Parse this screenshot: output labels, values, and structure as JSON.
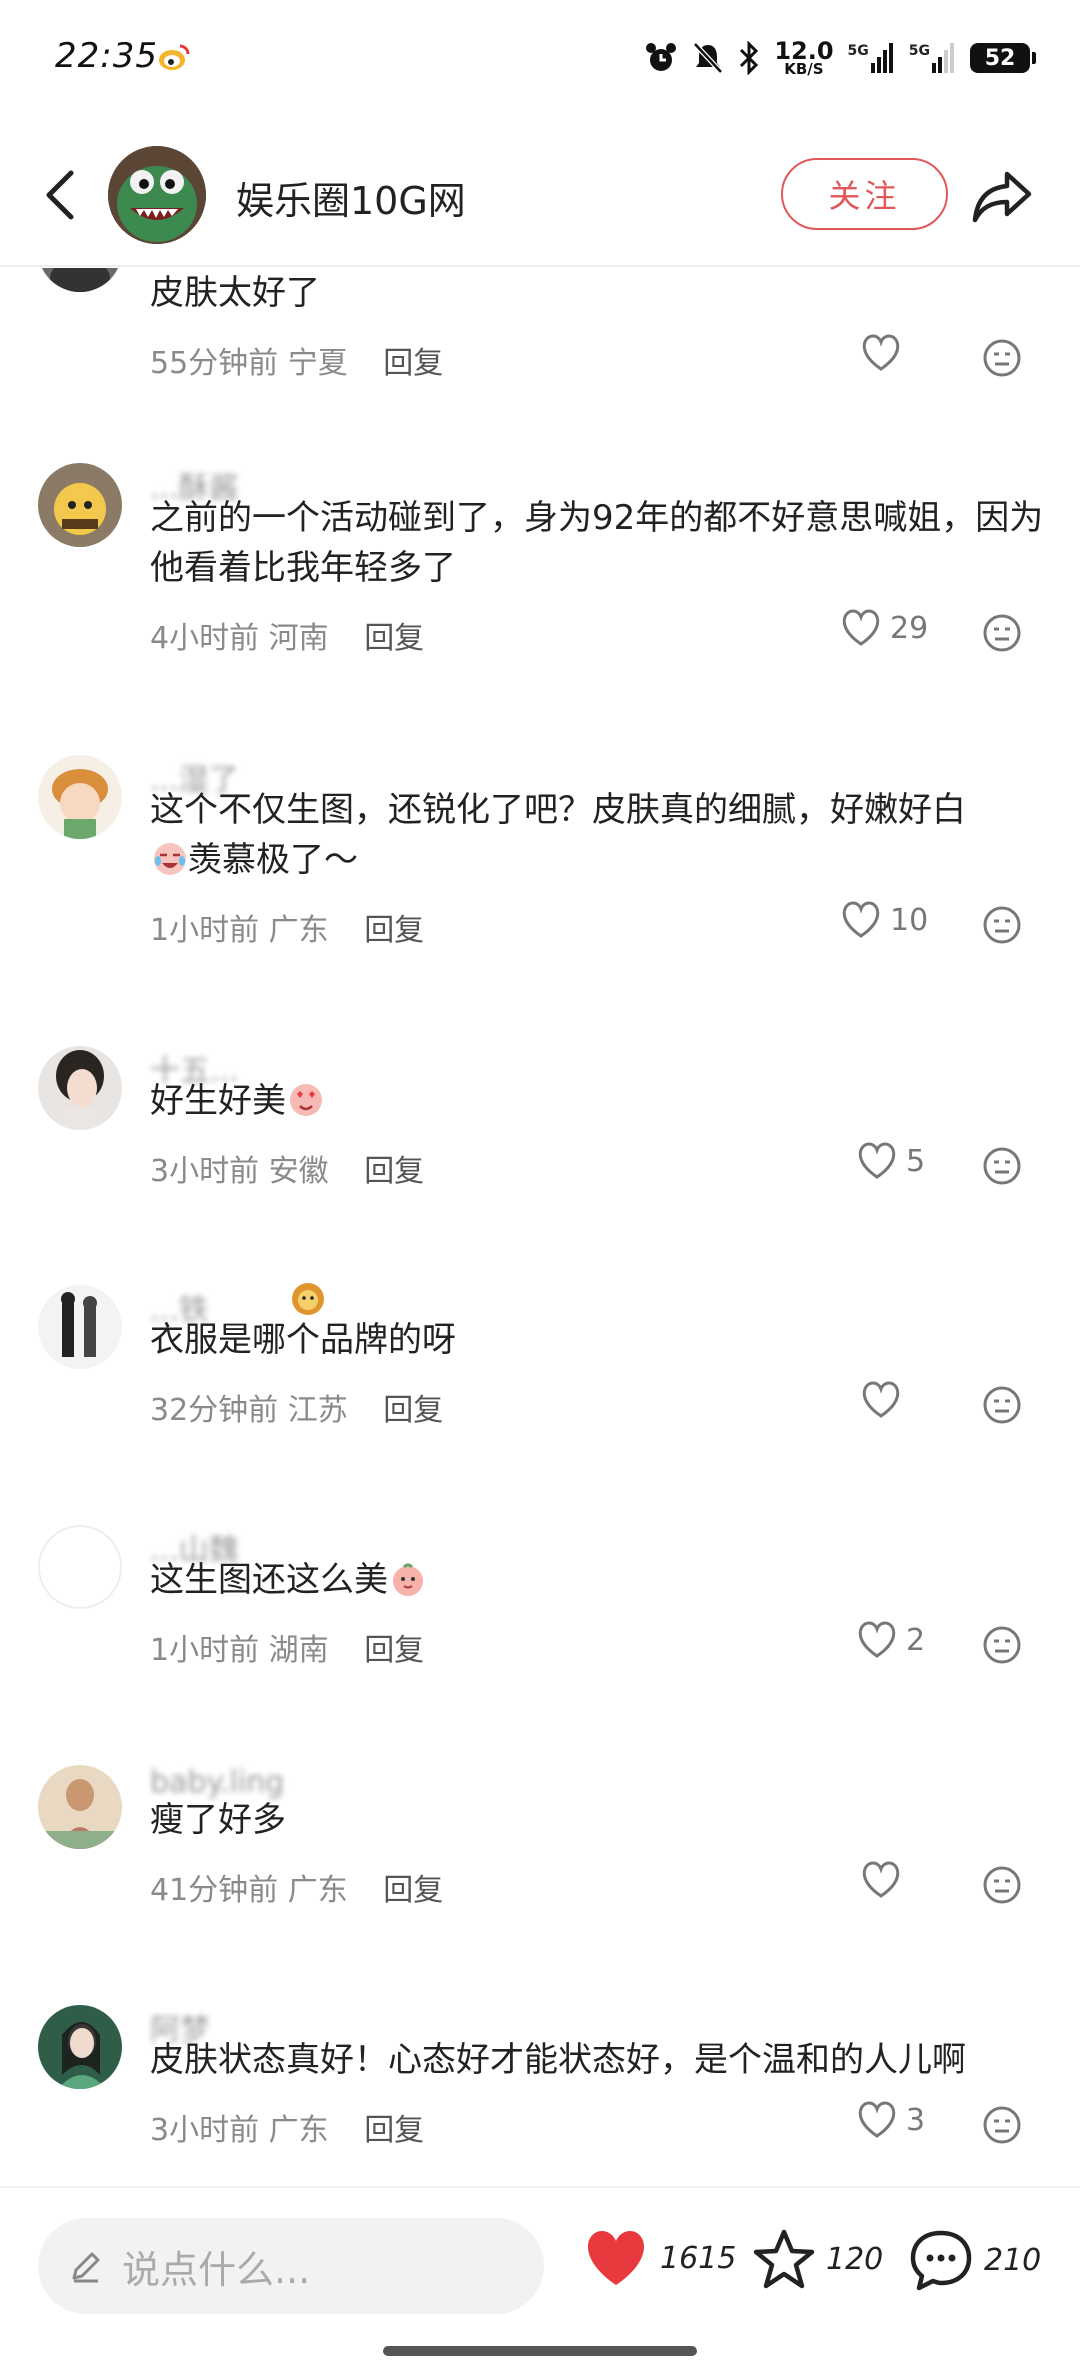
{
  "status_bar": {
    "time": "22:35",
    "net_speed_value": "12.0",
    "net_speed_unit": "KB/S",
    "signal_1": "5G",
    "signal_2": "5G",
    "battery": "52"
  },
  "header": {
    "title": "娱乐圈10G网",
    "follow_label": "关注"
  },
  "comments": [
    {
      "username": "",
      "text": "皮肤太好了",
      "time": "55分钟前",
      "location": "宁夏",
      "reply": "回复",
      "likes": ""
    },
    {
      "username": "...酥酱",
      "text": "之前的一个活动碰到了，身为92年的都不好意思喊姐，因为他看着比我年轻多了",
      "time": "4小时前",
      "location": "河南",
      "reply": "回复",
      "likes": "29"
    },
    {
      "username": "...湿了",
      "text": "这个不仅生图，还锐化了吧？皮肤真的细腻，好嫩好白",
      "text_after": "羡慕极了～",
      "time": "1小时前",
      "location": "广东",
      "reply": "回复",
      "likes": "10"
    },
    {
      "username": "十五...",
      "text": "好生好美",
      "time": "3小时前",
      "location": "安徽",
      "reply": "回复",
      "likes": "5"
    },
    {
      "username": "...铁",
      "text": "衣服是哪个品牌的呀",
      "time": "32分钟前",
      "location": "江苏",
      "reply": "回复",
      "likes": ""
    },
    {
      "username": "...山魏",
      "text": "这生图还这么美",
      "time": "1小时前",
      "location": "湖南",
      "reply": "回复",
      "likes": "2"
    },
    {
      "username": "baby.ling",
      "text": "瘦了好多",
      "time": "41分钟前",
      "location": "广东",
      "reply": "回复",
      "likes": ""
    },
    {
      "username": "阿梦",
      "text": "皮肤状态真好！心态好才能状态好，是个温和的人儿啊",
      "time": "3小时前",
      "location": "广东",
      "reply": "回复",
      "likes": "3"
    }
  ],
  "bottom_bar": {
    "input_placeholder": "说点什么...",
    "like_count": "1615",
    "favorite_count": "120",
    "comment_count": "210"
  },
  "colors": {
    "accent_red": "#e0585a",
    "heart_red": "#e8393f"
  },
  "icons": [
    "back-arrow-icon",
    "share-icon",
    "heart-icon",
    "neutral-face-icon",
    "pencil-icon",
    "star-icon",
    "chat-bubble-icon"
  ]
}
